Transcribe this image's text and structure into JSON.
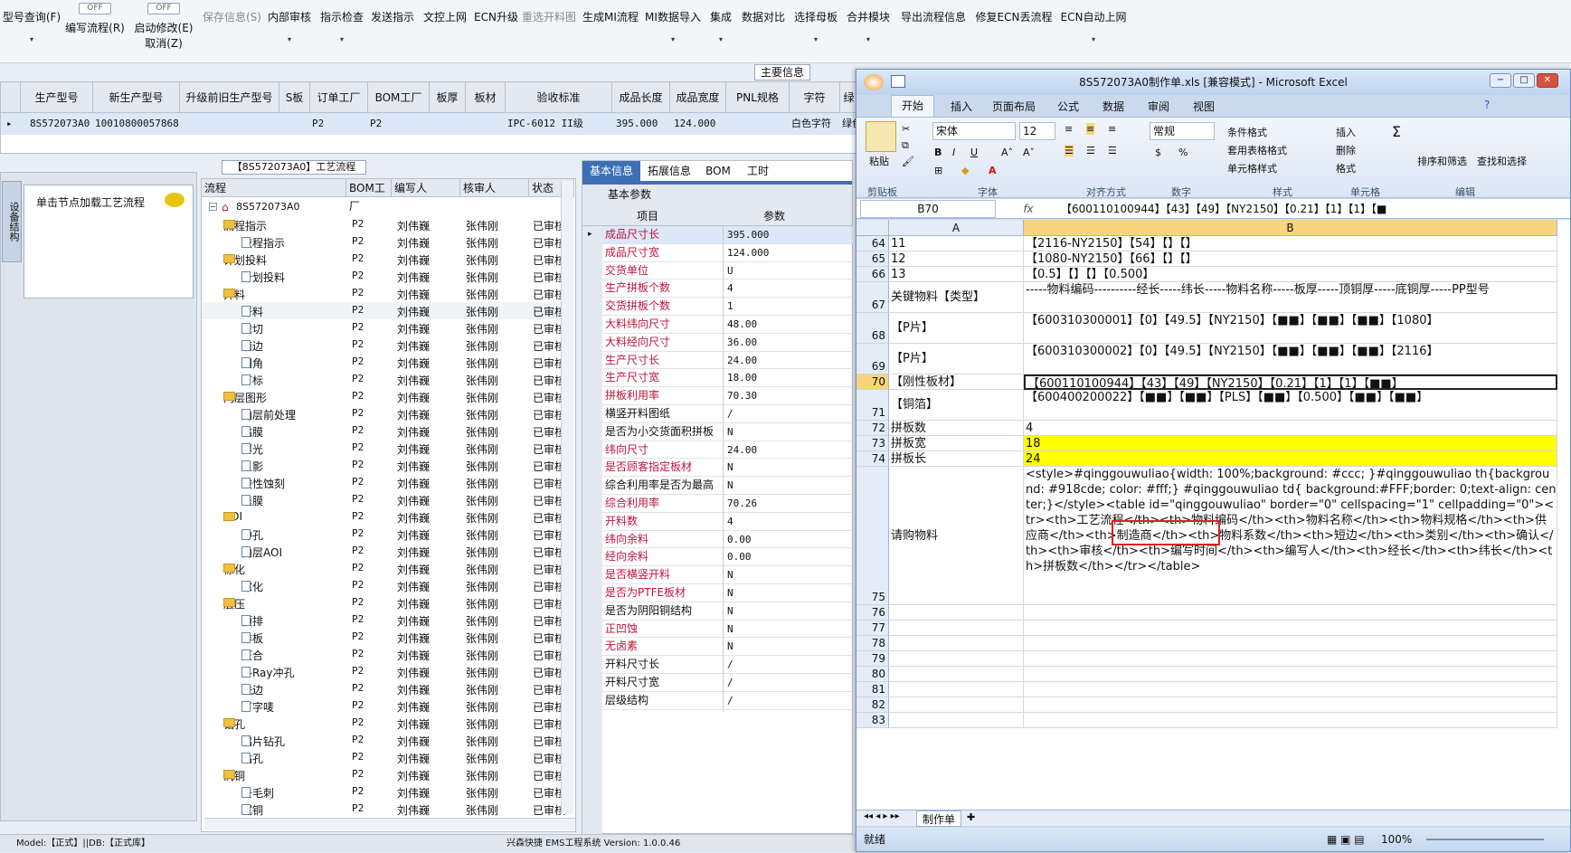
{
  "toolbar": {
    "items": [
      {
        "label": "型号查询(F)"
      },
      {
        "label": "编写流程(R)",
        "toggle": "OFF"
      },
      {
        "label": "启动修改(E)",
        "label2": "取消(Z)",
        "toggle": "OFF"
      },
      {
        "label": "保存信息(S)"
      },
      {
        "label": "内部审核"
      },
      {
        "label": "指示检查"
      },
      {
        "label": "发送指示"
      },
      {
        "label": "文控上网"
      },
      {
        "label": "ECN升级"
      },
      {
        "label": "重选开料图"
      },
      {
        "label": "生成MI流程"
      },
      {
        "label": "MI数据导入"
      },
      {
        "label": "集成"
      },
      {
        "label": "数据对比"
      },
      {
        "label": "选择母板"
      },
      {
        "label": "合并模块"
      },
      {
        "label": "导出流程信息"
      },
      {
        "label": "修复ECN丢流程"
      },
      {
        "label": "ECN自动上网"
      }
    ]
  },
  "info_tab": "主要信息",
  "top_grid": {
    "headers": [
      "生产型号",
      "新生产型号",
      "升级前旧生产型号",
      "S板",
      "订单工厂",
      "BOM工厂",
      "板厚",
      "板材",
      "验收标准",
      "成品长度",
      "成品宽度",
      "PNL规格",
      "字符",
      "绿"
    ],
    "row": [
      "8S572073A0",
      "10010800057868",
      "",
      "",
      "P2",
      "P2",
      "",
      "",
      "IPC-6012 II级",
      "395.000",
      "124.000",
      "",
      "白色字符",
      "绿色"
    ]
  },
  "left_panel": {
    "side_tab": "设备结构",
    "hint": "单击节点加载工艺流程"
  },
  "tree": {
    "title": "【8S572073A0】工艺流程",
    "headers": [
      "流程",
      "BOM工厂",
      "编写人",
      "核审人",
      "状态"
    ],
    "root": "8S572073A0",
    "rows": [
      {
        "name": "流程指示",
        "level": 1,
        "type": "folder",
        "factory": "P2",
        "writer": "刘伟巍",
        "reviewer": "张伟刚",
        "status": "已审核"
      },
      {
        "name": "流程指示",
        "level": 2,
        "type": "doc",
        "factory": "P2",
        "writer": "刘伟巍",
        "reviewer": "张伟刚",
        "status": "已审核"
      },
      {
        "name": "计划投料",
        "level": 1,
        "type": "folder",
        "factory": "P2",
        "writer": "刘伟巍",
        "reviewer": "张伟刚",
        "status": "已审核"
      },
      {
        "name": "计划投料",
        "level": 2,
        "type": "doc",
        "factory": "P2",
        "writer": "刘伟巍",
        "reviewer": "张伟刚",
        "status": "已审核"
      },
      {
        "name": "开料",
        "level": 1,
        "type": "folder",
        "factory": "P2",
        "writer": "刘伟巍",
        "reviewer": "张伟刚",
        "status": "已审核"
      },
      {
        "name": "开料",
        "level": 2,
        "type": "doc",
        "factory": "P2",
        "writer": "刘伟巍",
        "reviewer": "张伟刚",
        "status": "已审核"
      },
      {
        "name": "裁切",
        "level": 2,
        "type": "doc",
        "factory": "P2",
        "writer": "刘伟巍",
        "reviewer": "张伟刚",
        "status": "已审核"
      },
      {
        "name": "磨边",
        "level": 2,
        "type": "doc",
        "factory": "P2",
        "writer": "刘伟巍",
        "reviewer": "张伟刚",
        "status": "已审核"
      },
      {
        "name": "圆角",
        "level": 2,
        "type": "doc",
        "factory": "P2",
        "writer": "刘伟巍",
        "reviewer": "张伟刚",
        "status": "已审核"
      },
      {
        "name": "打标",
        "level": 2,
        "type": "doc",
        "factory": "P2",
        "writer": "刘伟巍",
        "reviewer": "张伟刚",
        "status": "已审核"
      },
      {
        "name": "内层图形",
        "level": 1,
        "type": "folder",
        "factory": "P2",
        "writer": "刘伟巍",
        "reviewer": "张伟刚",
        "status": "已审核"
      },
      {
        "name": "内层前处理",
        "level": 2,
        "type": "doc",
        "factory": "P2",
        "writer": "刘伟巍",
        "reviewer": "张伟刚",
        "status": "已审核"
      },
      {
        "name": "贴膜",
        "level": 2,
        "type": "doc",
        "factory": "P2",
        "writer": "刘伟巍",
        "reviewer": "张伟刚",
        "status": "已审核"
      },
      {
        "name": "曝光",
        "level": 2,
        "type": "doc",
        "factory": "P2",
        "writer": "刘伟巍",
        "reviewer": "张伟刚",
        "status": "已审核"
      },
      {
        "name": "显影",
        "level": 2,
        "type": "doc",
        "factory": "P2",
        "writer": "刘伟巍",
        "reviewer": "张伟刚",
        "status": "已审核"
      },
      {
        "name": "酸性蚀刻",
        "level": 2,
        "type": "doc",
        "factory": "P2",
        "writer": "刘伟巍",
        "reviewer": "张伟刚",
        "status": "已审核"
      },
      {
        "name": "退膜",
        "level": 2,
        "type": "doc",
        "factory": "P2",
        "writer": "刘伟巍",
        "reviewer": "张伟刚",
        "status": "已审核"
      },
      {
        "name": "AOI",
        "level": 1,
        "type": "folder",
        "factory": "P2",
        "writer": "刘伟巍",
        "reviewer": "张伟刚",
        "status": "已审核"
      },
      {
        "name": "冲孔",
        "level": 2,
        "type": "doc",
        "factory": "P2",
        "writer": "刘伟巍",
        "reviewer": "张伟刚",
        "status": "已审核"
      },
      {
        "name": "内层AOI",
        "level": 2,
        "type": "doc",
        "factory": "P2",
        "writer": "刘伟巍",
        "reviewer": "张伟刚",
        "status": "已审核"
      },
      {
        "name": "棕化",
        "level": 1,
        "type": "folder",
        "factory": "P2",
        "writer": "刘伟巍",
        "reviewer": "张伟刚",
        "status": "已审核"
      },
      {
        "name": "棕化",
        "level": 2,
        "type": "doc",
        "factory": "P2",
        "writer": "刘伟巍",
        "reviewer": "张伟刚",
        "status": "已审核"
      },
      {
        "name": "层压",
        "level": 1,
        "type": "folder",
        "factory": "P2",
        "writer": "刘伟巍",
        "reviewer": "张伟刚",
        "status": "已审核"
      },
      {
        "name": "预排",
        "level": 2,
        "type": "doc",
        "factory": "P2",
        "writer": "刘伟巍",
        "reviewer": "张伟刚",
        "status": "已审核"
      },
      {
        "name": "排板",
        "level": 2,
        "type": "doc",
        "factory": "P2",
        "writer": "刘伟巍",
        "reviewer": "张伟刚",
        "status": "已审核"
      },
      {
        "name": "压合",
        "level": 2,
        "type": "doc",
        "factory": "P2",
        "writer": "刘伟巍",
        "reviewer": "张伟刚",
        "status": "已审核"
      },
      {
        "name": "X-Ray冲孔",
        "level": 2,
        "type": "doc",
        "factory": "P2",
        "writer": "刘伟巍",
        "reviewer": "张伟刚",
        "status": "已审核"
      },
      {
        "name": "铣边",
        "level": 2,
        "type": "doc",
        "factory": "P2",
        "writer": "刘伟巍",
        "reviewer": "张伟刚",
        "status": "已审核"
      },
      {
        "name": "打字唛",
        "level": 2,
        "type": "doc",
        "factory": "P2",
        "writer": "刘伟巍",
        "reviewer": "张伟刚",
        "status": "已审核"
      },
      {
        "name": "钻孔",
        "level": 1,
        "type": "folder",
        "factory": "P2",
        "writer": "刘伟巍",
        "reviewer": "张伟刚",
        "status": "已审核"
      },
      {
        "name": "铝片钻孔",
        "level": 2,
        "type": "doc",
        "factory": "P2",
        "writer": "刘伟巍",
        "reviewer": "张伟刚",
        "status": "已审核"
      },
      {
        "name": "钻孔",
        "level": 2,
        "type": "doc",
        "factory": "P2",
        "writer": "刘伟巍",
        "reviewer": "张伟刚",
        "status": "已审核"
      },
      {
        "name": "沉铜",
        "level": 1,
        "type": "folder",
        "factory": "P2",
        "writer": "刘伟巍",
        "reviewer": "张伟刚",
        "status": "已审核"
      },
      {
        "name": "去毛刺",
        "level": 2,
        "type": "doc",
        "factory": "P2",
        "writer": "刘伟巍",
        "reviewer": "张伟刚",
        "status": "已审核"
      },
      {
        "name": "沉铜",
        "level": 2,
        "type": "doc",
        "factory": "P2",
        "writer": "刘伟巍",
        "reviewer": "张伟刚",
        "status": "已审核"
      }
    ]
  },
  "props": {
    "tabs": [
      "基本信息",
      "拓展信息",
      "BOM",
      "工时"
    ],
    "section": "基本参数",
    "col_item": "项目",
    "col_param": "参数",
    "rows": [
      {
        "k": "成品尺寸长",
        "v": "395.000",
        "red": true
      },
      {
        "k": "成品尺寸宽",
        "v": "124.000",
        "red": true
      },
      {
        "k": "交货单位",
        "v": "U",
        "red": true
      },
      {
        "k": "生产拼板个数",
        "v": "4",
        "red": true
      },
      {
        "k": "交货拼板个数",
        "v": "1",
        "red": true
      },
      {
        "k": "大料纬向尺寸",
        "v": "48.00",
        "red": true
      },
      {
        "k": "大料经向尺寸",
        "v": "36.00",
        "red": true
      },
      {
        "k": "生产尺寸长",
        "v": "24.00",
        "red": true
      },
      {
        "k": "生产尺寸宽",
        "v": "18.00",
        "red": true
      },
      {
        "k": "拼板利用率",
        "v": "70.30",
        "red": true
      },
      {
        "k": "横竖开料图纸",
        "v": "/",
        "red": false
      },
      {
        "k": "是否为小交货面积拼板",
        "v": "N",
        "red": false
      },
      {
        "k": "纬向尺寸",
        "v": "24.00",
        "red": true
      },
      {
        "k": "是否顾客指定板材",
        "v": "N",
        "red": true
      },
      {
        "k": "综合利用率是否为最高",
        "v": "N",
        "red": false
      },
      {
        "k": "综合利用率",
        "v": "70.26",
        "red": true
      },
      {
        "k": "开料数",
        "v": "4",
        "red": true
      },
      {
        "k": "纬向余料",
        "v": "0.00",
        "red": true
      },
      {
        "k": "经向余料",
        "v": "0.00",
        "red": true
      },
      {
        "k": "是否横竖开料",
        "v": "N",
        "red": true
      },
      {
        "k": "是否为PTFE板材",
        "v": "N",
        "red": true
      },
      {
        "k": "是否为阴阳铜结构",
        "v": "N",
        "red": false
      },
      {
        "k": "正凹蚀",
        "v": "N",
        "red": true
      },
      {
        "k": "无卤素",
        "v": "N",
        "red": true
      },
      {
        "k": "开料尺寸长",
        "v": "/",
        "red": false
      },
      {
        "k": "开料尺寸宽",
        "v": "/",
        "red": false
      },
      {
        "k": "层级结构",
        "v": "/",
        "red": false
      }
    ]
  },
  "statusbar": {
    "left": "Model:【正式】||DB:【正式库】",
    "center": "兴森快捷  EMS工程系统  Version: 1.0.0.46"
  },
  "excel": {
    "title": "8S572073A0制作单.xls [兼容模式] - Microsoft Excel",
    "ribbon_tabs": [
      "开始",
      "插入",
      "页面布局",
      "公式",
      "数据",
      "审阅",
      "视图"
    ],
    "groups": [
      "剪贴板",
      "字体",
      "对齐方式",
      "数字",
      "样式",
      "单元格",
      "编辑"
    ],
    "font_name": "宋体",
    "font_size": "12",
    "number_format": "常规",
    "paste": "粘贴",
    "style_buttons": [
      "条件格式",
      "套用表格格式",
      "单元格样式"
    ],
    "cell_buttons": [
      "插入",
      "删除",
      "格式"
    ],
    "edit_buttons": [
      "排序和筛选",
      "查找和选择"
    ],
    "name_box": "B70",
    "formula": "【600110100944】【43】【49】【NY2150】【0.21】【1】【1】【■",
    "col_a": "A",
    "col_b": "B",
    "rows": [
      {
        "n": "64",
        "a": "11",
        "b": "【2116-NY2150】【54】【】【】",
        "h": 17
      },
      {
        "n": "65",
        "a": "12",
        "b": "【1080-NY2150】【66】【】【】",
        "h": 17
      },
      {
        "n": "66",
        "a": "13",
        "b": "【0.5】【】【】【0.500】",
        "h": 17
      },
      {
        "n": "67",
        "a": "关键物料【类型】",
        "b": "-----物料编码----------经长-----纬长-----物料名称-----板厚-----顶铜厚-----底铜厚-----PP型号",
        "h": 34
      },
      {
        "n": "68",
        "a": "【P片】",
        "b": "【600310300001】【0】【49.5】【NY2150】【■■】【■■】【■■】【1080】",
        "h": 34
      },
      {
        "n": "69",
        "a": "【P片】",
        "b": "【600310300002】【0】【49.5】【NY2150】【■■】【■■】【■■】【2116】",
        "h": 34
      },
      {
        "n": "70",
        "a": "【刚性板材】",
        "b": "【600110100944】【43】【49】【NY2150】【0.21】【1】【1】【■■】",
        "h": 17
      },
      {
        "n": "71",
        "a": "【铜箔】",
        "b": "【600400200022】【■■】【■■】【PLS】【■■】【0.500】【■■】【■■】",
        "h": 34
      },
      {
        "n": "72",
        "a": "拼板数",
        "b": "4",
        "h": 17
      },
      {
        "n": "73",
        "a": "拼板宽",
        "b": "18",
        "h": 17,
        "yellow": true
      },
      {
        "n": "74",
        "a": "拼板长",
        "b": "24",
        "h": 17,
        "yellow": true
      },
      {
        "n": "75",
        "a": "请购物料",
        "b": "<style>#qinggouwuliao{width: 100%;background: #ccc; }#qinggouwuliao th{background: #918cde; color: #fff;} #qinggouwuliao td{ background:#FFF;border: 0;text-align: center;}</style><table id=\"qinggouwuliao\" border=\"0\" cellspacing=\"1\" cellpadding=\"0\"><tr><th>工艺流程</th><th>物料编码</th><th>物料名称</th><th>物料规格</th><th>供应商</th><th>制造商</th><th>物料系数</th><th>短边</th><th>类别</th><th>确认</th><th>审核</th><th>编写时间</th><th>编写人</th><th>经长</th><th>纬长</th><th>拼板数</th></tr></table>",
        "h": 153
      },
      {
        "n": "76",
        "a": "",
        "b": "",
        "h": 17
      },
      {
        "n": "77",
        "a": "",
        "b": "",
        "h": 17
      },
      {
        "n": "78",
        "a": "",
        "b": "",
        "h": 17
      },
      {
        "n": "79",
        "a": "",
        "b": "",
        "h": 17
      },
      {
        "n": "80",
        "a": "",
        "b": "",
        "h": 17
      },
      {
        "n": "81",
        "a": "",
        "b": "",
        "h": 17
      },
      {
        "n": "82",
        "a": "",
        "b": "",
        "h": 17
      },
      {
        "n": "83",
        "a": "",
        "b": "",
        "h": 17
      }
    ],
    "sheet_tab": "制作单",
    "status_ready": "就绪",
    "zoom": "100%"
  },
  "colors": {
    "accent": "#3d6fb6",
    "red_label": "#c0143c",
    "highlight": "#ffff00"
  }
}
